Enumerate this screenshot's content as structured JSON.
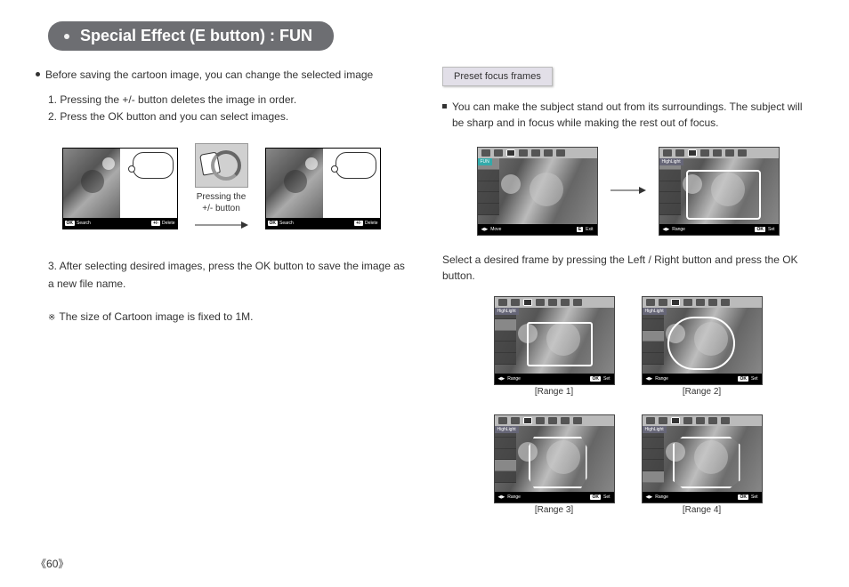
{
  "title": "Special Effect (E button)  :    FUN",
  "left": {
    "intro": "Before saving the cartoon image, you can change the selected image",
    "step1": "1. Pressing the +/- button deletes the image in order.",
    "step2": "2. Press the OK button and you can select images.",
    "mid_label_1": "Pressing the",
    "mid_label_2": "+/- button",
    "step3": "3. After selecting desired images, press the OK button to save the image as a new file name.",
    "note_symbol": "※",
    "note": "The size of Cartoon image is fixed to 1M.",
    "bar_ok": "OK",
    "bar_search": "Search",
    "bar_pm": "+/-",
    "bar_delete": "Delete"
  },
  "right": {
    "section_label": "Preset focus frames",
    "intro": "You can make the subject stand out from its surroundings. The subject will be sharp and in focus while making the rest out of focus.",
    "select_text": "Select a desired frame by pressing the Left / Right button and press the OK button.",
    "tag_fun": "FUN",
    "tag_hl": "HighLight",
    "bar_move": "Move",
    "bar_e": "E",
    "bar_exit": "Exit",
    "bar_range": "Range",
    "bar_ok": "OK",
    "bar_set": "Set",
    "ranges": [
      "[Range 1]",
      "[Range 2]",
      "[Range 3]",
      "[Range 4]"
    ]
  },
  "page_number": "60"
}
